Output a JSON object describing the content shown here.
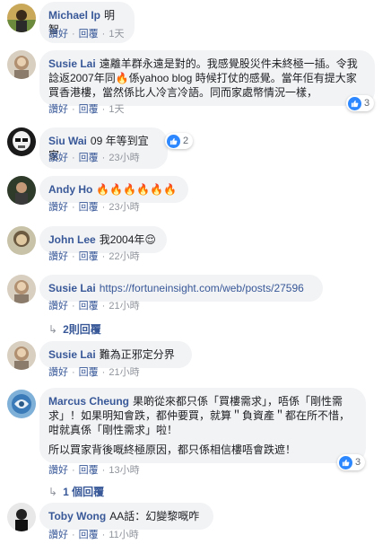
{
  "labels": {
    "like": "讚好",
    "reply": "回覆",
    "sep": "·"
  },
  "comments": [
    {
      "author": "Michael Ip",
      "text": "明智",
      "time": "1天"
    },
    {
      "author": "Susie Lai",
      "text": "遠離羊群永遠是對的。我感覺股災件未終極一插。令我諗返2007年同🔥係yahoo blog 時候打仗的感覺。當年佢有提大家買香港樓，當然係比人冷言冷語。同而家處幣情況一樣，",
      "time": "1天",
      "reactions": "3"
    },
    {
      "author": "Siu Wai",
      "text": "09 年等到宜家",
      "time": "23小時",
      "reactions": "2"
    },
    {
      "author": "Andy Ho",
      "text": "🔥🔥🔥🔥🔥🔥",
      "time": "23小時"
    },
    {
      "author": "John Lee",
      "text": "我2004年😌",
      "time": "22小時"
    },
    {
      "author": "Susie Lai",
      "text": "https://fortuneinsight.com/web/posts/27596",
      "time": "21小時",
      "replies": "2則回覆"
    },
    {
      "author": "Susie Lai",
      "text": "難為正邪定分界",
      "time": "21小時"
    },
    {
      "author": "Marcus Cheung",
      "text": "果啲從來都只係「買樓需求」，唔係「剛性需求」！如果明知會跌，都仲要買，就算＂負資產＂都在所不惜，咁就真係「剛性需求」啦！",
      "text2": "所以買家背後嘅終極原因，都只係相信樓唔會跌遮！",
      "time": "13小時",
      "reactions": "3",
      "replies": "1 個回覆"
    },
    {
      "author": "Toby Wong",
      "text": "AA話：幻變黎嘅咋",
      "time": "11小時"
    }
  ],
  "colors": {
    "link": "#385898",
    "bubble": "#f2f3f5",
    "like": "#2d88ff",
    "meta": "#90949c"
  }
}
